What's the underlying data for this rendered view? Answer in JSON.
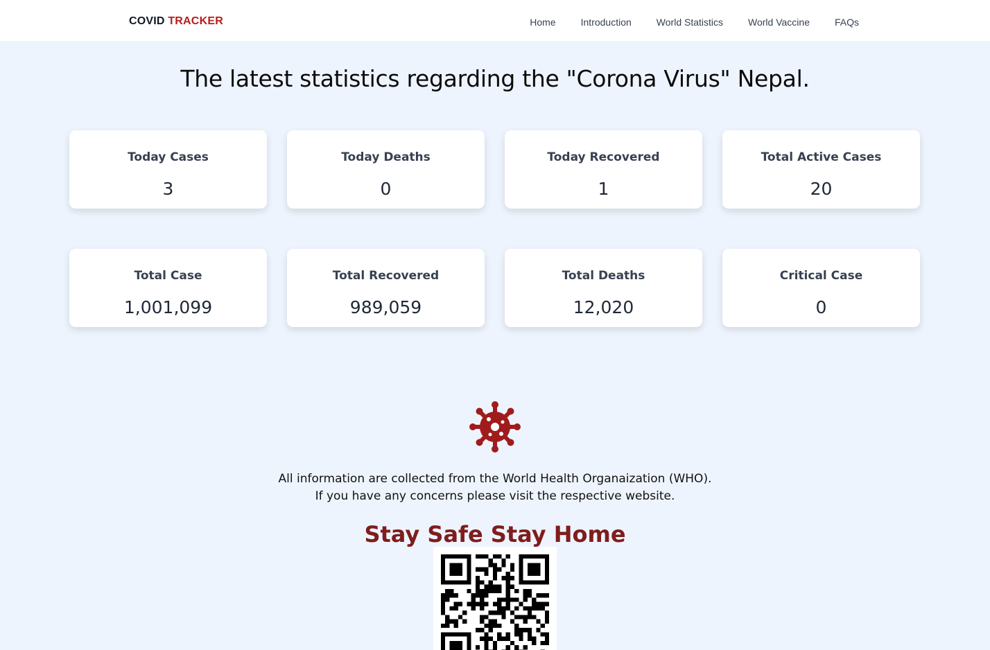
{
  "brand": {
    "part1": "COVID",
    "part2": "TRACKER"
  },
  "nav": {
    "items": [
      "Home",
      "Introduction",
      "World Statistics",
      "World Vaccine",
      "FAQs"
    ]
  },
  "title": "The latest statistics regarding the \"Corona Virus\" Nepal.",
  "stats": [
    {
      "label": "Today Cases",
      "value": "3"
    },
    {
      "label": "Today Deaths",
      "value": "0"
    },
    {
      "label": "Today Recovered",
      "value": "1"
    },
    {
      "label": "Total Active Cases",
      "value": "20"
    },
    {
      "label": "Total Case",
      "value": "1,001,099"
    },
    {
      "label": "Total Recovered",
      "value": "989,059"
    },
    {
      "label": "Total Deaths",
      "value": "12,020"
    },
    {
      "label": "Critical Case",
      "value": "0"
    }
  ],
  "info": {
    "line1": "All information are collected from the World Health Organaization (WHO).",
    "line2": "If you have any concerns please visit the respective website."
  },
  "slogan": "Stay Safe Stay Home",
  "colors": {
    "accent": "#b91c1c",
    "slogan": "#7f1d1d",
    "background": "#eef4fd"
  },
  "icons": {
    "virus": "virus-icon",
    "qr": "qr-code"
  }
}
